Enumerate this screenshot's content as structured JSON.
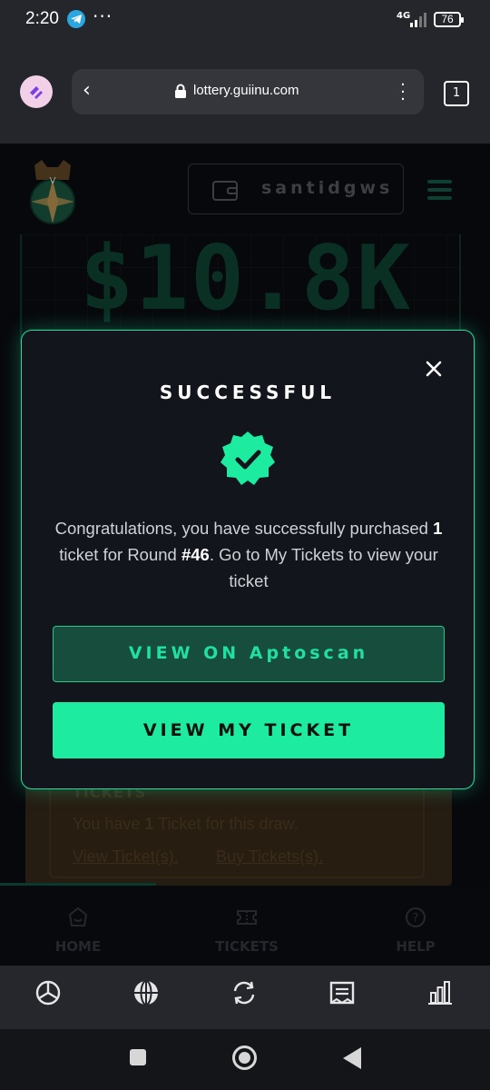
{
  "status_bar": {
    "time": "2:20",
    "more": "···",
    "network": "4G",
    "battery": "76"
  },
  "browser": {
    "url": "lottery.guiinu.com",
    "tab_count": "1"
  },
  "page": {
    "wallet_name": "santidgws",
    "jackpot": "$10.8K",
    "tickets_card": {
      "heading": "TICKETS",
      "line_prefix": "You have ",
      "line_count": "1",
      "line_suffix": " Ticket for this draw.",
      "view_link": "View Ticket(s).",
      "buy_link": "Buy Tickets(s)."
    },
    "nav": [
      {
        "label": "HOME"
      },
      {
        "label": "TICKETS"
      },
      {
        "label": "HELP"
      }
    ]
  },
  "modal": {
    "title": "SUCCESSFUL",
    "msg_part1": "Congratulations, you have successfully purchased ",
    "msg_count": "1",
    "msg_part2": " ticket for Round ",
    "msg_round": "#46",
    "msg_part3": ". Go to My Tickets to view your ticket",
    "btn_scan": "VIEW ON Aptoscan",
    "btn_ticket": "VIEW MY TICKET"
  },
  "colors": {
    "accent": "#1deb9f",
    "modal_bg": "#12151c",
    "page_bg": "#0b0d11"
  }
}
